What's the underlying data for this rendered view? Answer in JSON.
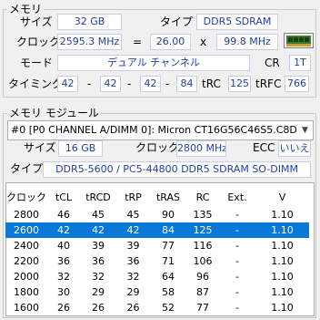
{
  "memory": {
    "group_title": "メモリ",
    "size_label": "サイズ",
    "size_value": "32 GB",
    "type_label": "タイプ",
    "type_value": "DDR5 SDRAM",
    "clock_label": "クロック",
    "clock_value": "2595.3 MHz",
    "equals": "=",
    "multiplier": "26.00",
    "times": "x",
    "bus_speed": "99.8 MHz",
    "mode_label": "モード",
    "mode_value": "デュアル チャンネル",
    "cr_label": "CR",
    "cr_value": "1T",
    "timing_label": "タイミング",
    "timings": [
      "42",
      "42",
      "42",
      "84"
    ],
    "dash": "-",
    "trc_label": "tRC",
    "trc_value": "125",
    "trfc_label": "tRFC",
    "trfc_value": "766"
  },
  "module": {
    "group_title": "メモリ モジュール",
    "selected_slot": "#0 [P0 CHANNEL A/DIMM 0]: Micron CT16G56C46S5.C8D",
    "size_label": "サイズ",
    "size_value": "16 GB",
    "clock_label": "クロック",
    "clock_value": "2800 MHz",
    "ecc_label": "ECC",
    "ecc_value": "いいえ",
    "type_label": "タイプ",
    "type_value": "DDR5-5600 / PC5-44800 DDR5 SDRAM SO-DIMM"
  },
  "table": {
    "headers": [
      "クロック",
      "tCL",
      "tRCD",
      "tRP",
      "tRAS",
      "RC",
      "Ext.",
      "V"
    ],
    "rows": [
      [
        "2800",
        "46",
        "45",
        "45",
        "90",
        "135",
        "-",
        "1.10"
      ],
      [
        "2600",
        "42",
        "42",
        "42",
        "84",
        "125",
        "-",
        "1.10"
      ],
      [
        "2400",
        "40",
        "39",
        "39",
        "77",
        "116",
        "-",
        "1.10"
      ],
      [
        "2200",
        "36",
        "36",
        "36",
        "71",
        "106",
        "-",
        "1.10"
      ],
      [
        "2000",
        "32",
        "32",
        "32",
        "64",
        "96",
        "-",
        "1.10"
      ],
      [
        "1800",
        "30",
        "29",
        "29",
        "58",
        "87",
        "-",
        "1.10"
      ],
      [
        "1600",
        "26",
        "26",
        "26",
        "52",
        "77",
        "-",
        "1.10"
      ]
    ],
    "selected_row": 1
  }
}
